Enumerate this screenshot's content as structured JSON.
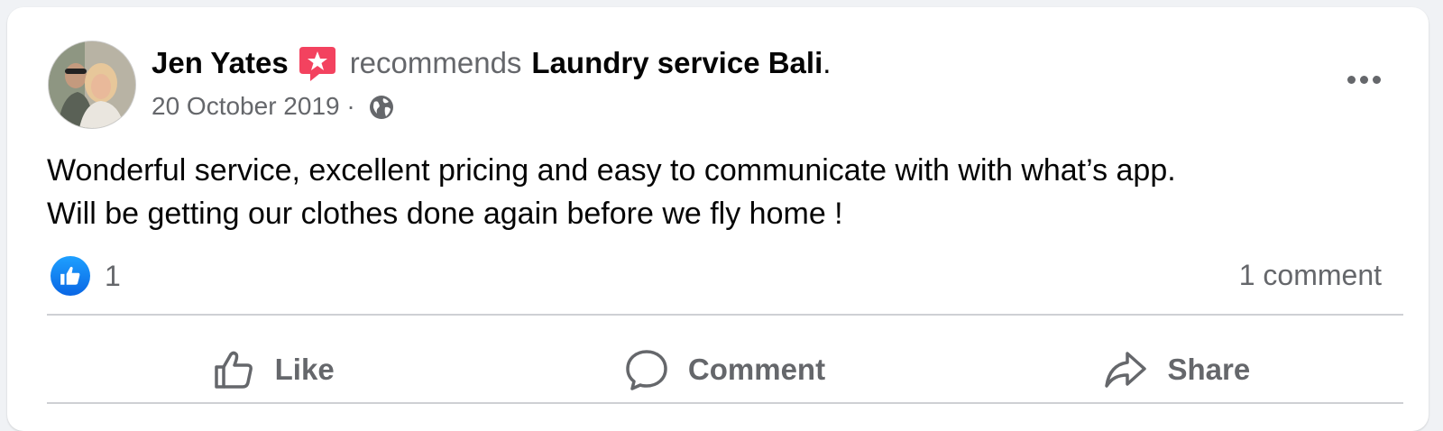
{
  "post": {
    "author": "Jen Yates",
    "recommends_text": "recommends",
    "page_name": "Laundry service Bali",
    "page_suffix": ".",
    "date": "20 October 2019",
    "separator": " · ",
    "privacy_icon": "globe-icon",
    "body": "Wonderful service, excellent pricing and easy to communicate with with what’s app.\nWill be getting our clothes done again before we fly home !"
  },
  "stats": {
    "like_count": "1",
    "comment_count": "1 comment"
  },
  "actions": {
    "like": "Like",
    "comment": "Comment",
    "share": "Share"
  },
  "colors": {
    "recommend_badge": "#f3425f",
    "like_blue": "#1877f2",
    "secondary_text": "#65676b"
  }
}
